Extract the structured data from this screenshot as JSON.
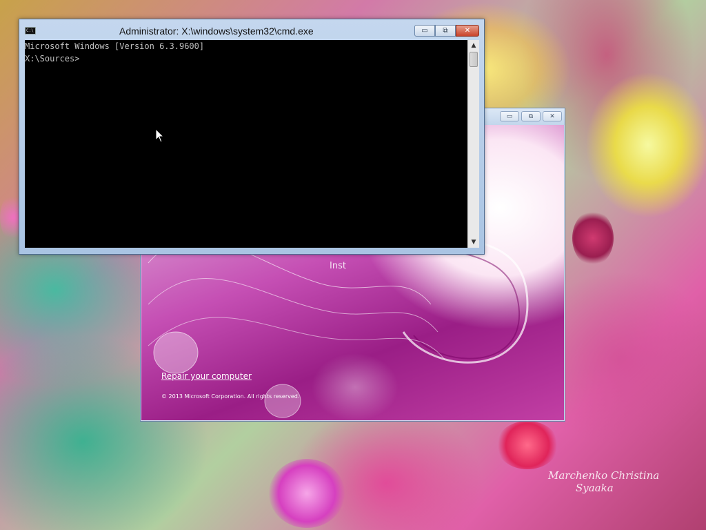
{
  "desktop": {
    "watermark_line1": "Marchenko Christina",
    "watermark_line2": "Syaaka"
  },
  "setup_window": {
    "minimize_glyph": "▭",
    "restore_glyph": "⧉",
    "close_glyph": "✕",
    "install_text": "Inst",
    "repair_link": "Repair your computer",
    "copyright": "© 2013 Microsoft Corporation. All rights reserved."
  },
  "cmd_window": {
    "title": "Administrator: X:\\windows\\system32\\cmd.exe",
    "icon_label": "C:\\",
    "minimize_glyph": "▭",
    "restore_glyph": "⧉",
    "close_glyph": "✕",
    "console_lines": [
      "Microsoft Windows [Version 6.3.9600]",
      "",
      "X:\\Sources>"
    ],
    "scroll_up_glyph": "▲",
    "scroll_down_glyph": "▼"
  },
  "colors": {
    "console_bg": "#000000",
    "console_fg": "#c0c0c0",
    "close_button": "#c9432a"
  }
}
